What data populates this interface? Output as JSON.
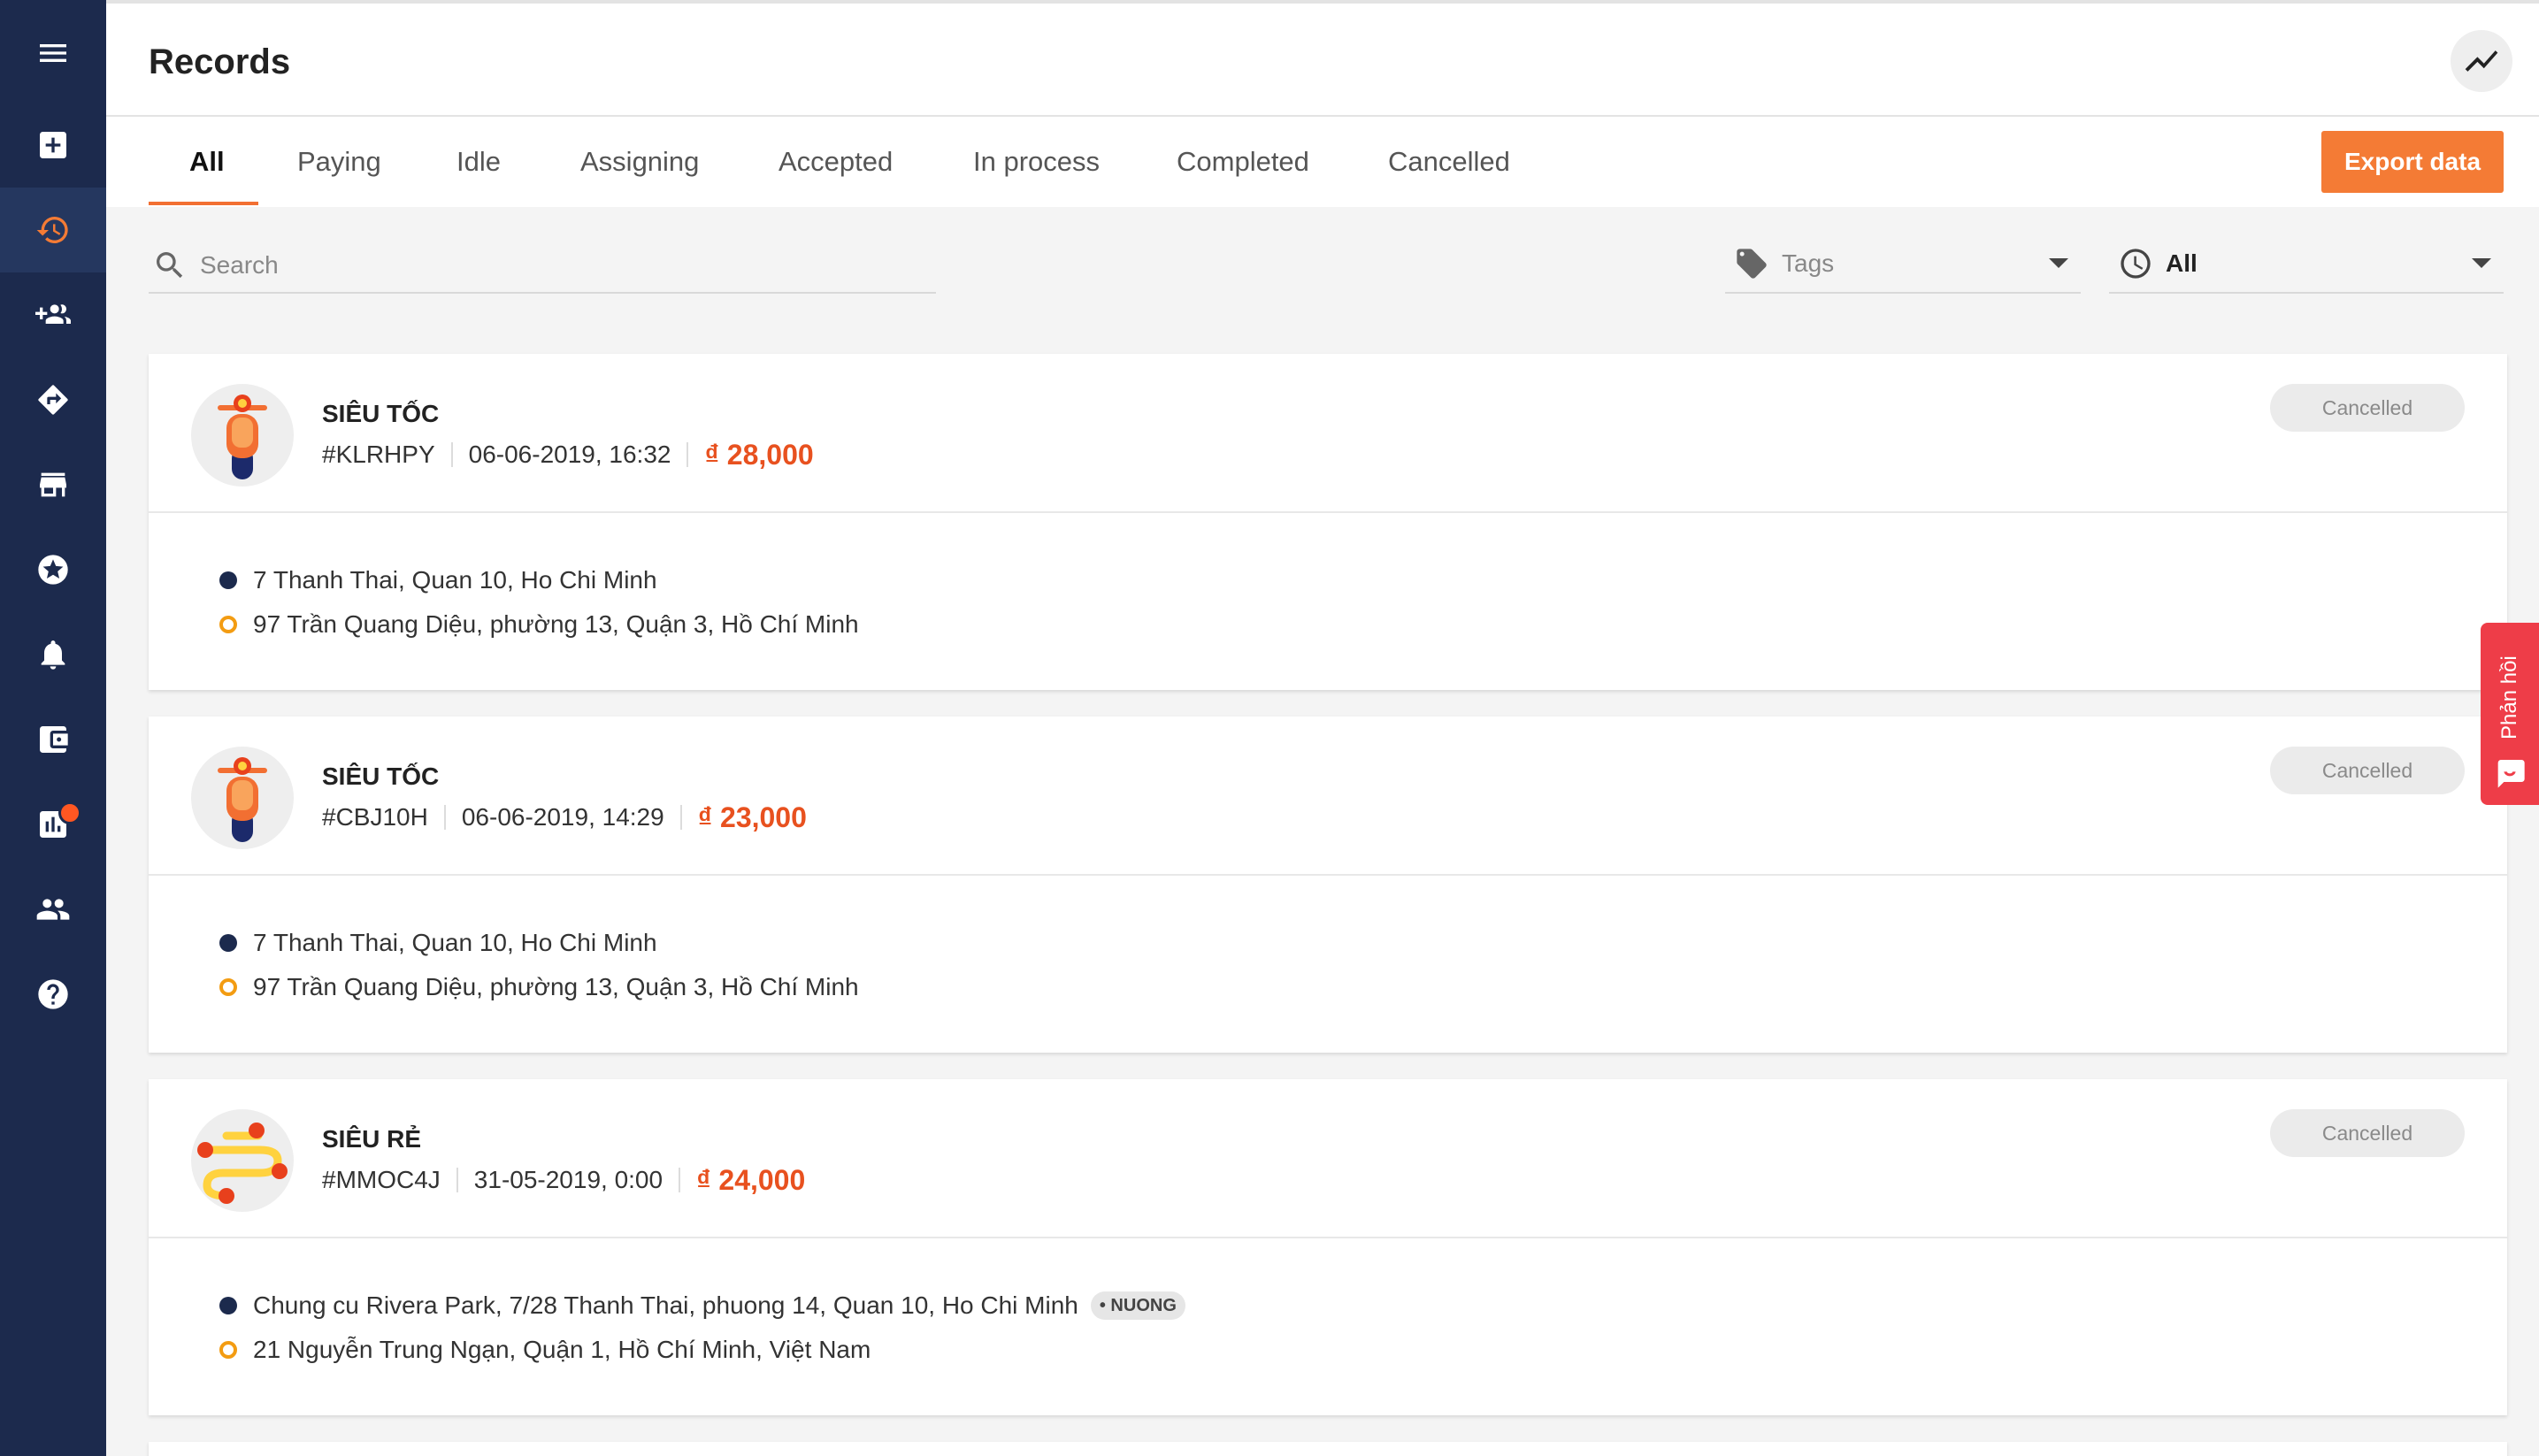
{
  "page": {
    "title": "Records"
  },
  "sidebar": {
    "items": [
      {
        "icon": "menu-icon"
      },
      {
        "icon": "add-box-icon"
      },
      {
        "icon": "history-icon",
        "active": true
      },
      {
        "icon": "add-group-icon"
      },
      {
        "icon": "directions-icon"
      },
      {
        "icon": "store-icon"
      },
      {
        "icon": "star-badge-icon"
      },
      {
        "icon": "bell-icon"
      },
      {
        "icon": "wallet-icon"
      },
      {
        "icon": "report-icon",
        "badge": true
      },
      {
        "icon": "people-icon"
      },
      {
        "icon": "help-icon"
      }
    ]
  },
  "tabs": [
    "All",
    "Paying",
    "Idle",
    "Assigning",
    "Accepted",
    "In process",
    "Completed",
    "Cancelled"
  ],
  "active_tab": "All",
  "export_label": "Export data",
  "search": {
    "placeholder": "Search",
    "value": ""
  },
  "tags_filter": {
    "placeholder": "Tags"
  },
  "time_filter": {
    "value": "All"
  },
  "records": [
    {
      "service": "SIÊU TỐC",
      "service_icon": "scooter-icon",
      "code": "#KLRHPY",
      "datetime": "06-06-2019, 16:32",
      "price": "₫ 28,000",
      "status": "Cancelled",
      "pickup": "7 Thanh Thai, Quan 10, Ho Chi Minh",
      "dropoff": "97 Trần Quang Diệu, phường 13, Quận 3, Hồ Chí Minh",
      "tag": ""
    },
    {
      "service": "SIÊU TỐC",
      "service_icon": "scooter-icon",
      "code": "#CBJ10H",
      "datetime": "06-06-2019, 14:29",
      "price": "₫ 23,000",
      "status": "Cancelled",
      "pickup": "7 Thanh Thai, Quan 10, Ho Chi Minh",
      "dropoff": "97 Trần Quang Diệu, phường 13, Quận 3, Hồ Chí Minh",
      "tag": ""
    },
    {
      "service": "SIÊU RẺ",
      "service_icon": "route-icon",
      "code": "#MMOC4J",
      "datetime": "31-05-2019, 0:00",
      "price": "₫ 24,000",
      "status": "Cancelled",
      "pickup": "Chung cu Rivera Park, 7/28 Thanh Thai, phuong 14, Quan 10, Ho Chi Minh",
      "dropoff": "21 Nguyễn Trung Ngạn, Quận 1, Hồ Chí Minh, Việt Nam",
      "tag": "• NUONG"
    }
  ],
  "feedback": {
    "label": "Phản hồi"
  },
  "colors": {
    "sidebar": "#1c2a4d",
    "accent": "#f47b35",
    "price": "#e8511f",
    "feedback": "#ee3d48"
  }
}
